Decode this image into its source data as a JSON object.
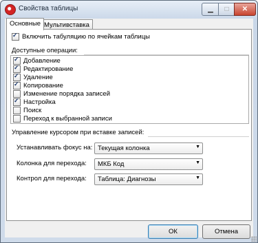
{
  "window": {
    "title": "Свойства таблицы"
  },
  "tabs": [
    {
      "label": "Основные"
    },
    {
      "label": "Мультивставка"
    }
  ],
  "main": {
    "enable_tabulation_label": "Включить табуляцию по ячейкам таблицы",
    "enable_tabulation_checked": true,
    "ops_title": "Доступные операции:",
    "ops": [
      {
        "label": "Добавление",
        "checked": true
      },
      {
        "label": "Редактирование",
        "checked": true
      },
      {
        "label": "Удаление",
        "checked": true
      },
      {
        "label": "Копирование",
        "checked": true
      },
      {
        "label": "Изменение порядка записей",
        "checked": false
      },
      {
        "label": "Настройка",
        "checked": true
      },
      {
        "label": "Поиск",
        "checked": false
      },
      {
        "label": "Переход к выбранной записи",
        "checked": false
      }
    ],
    "cursor_title": "Управление курсором при вставке записей:",
    "fields": [
      {
        "label": "Устанавливать фокус на:",
        "value": "Текущая колонка"
      },
      {
        "label": "Колонка для перехода:",
        "value": "МКБ Код"
      },
      {
        "label": "Контрол для перехода:",
        "value": "Таблица: Диагнозы"
      }
    ]
  },
  "buttons": {
    "ok": "ОК",
    "cancel": "Отмена"
  },
  "colors": {
    "close_button": "#c8452f",
    "title_bar": "#c9d7e8"
  }
}
